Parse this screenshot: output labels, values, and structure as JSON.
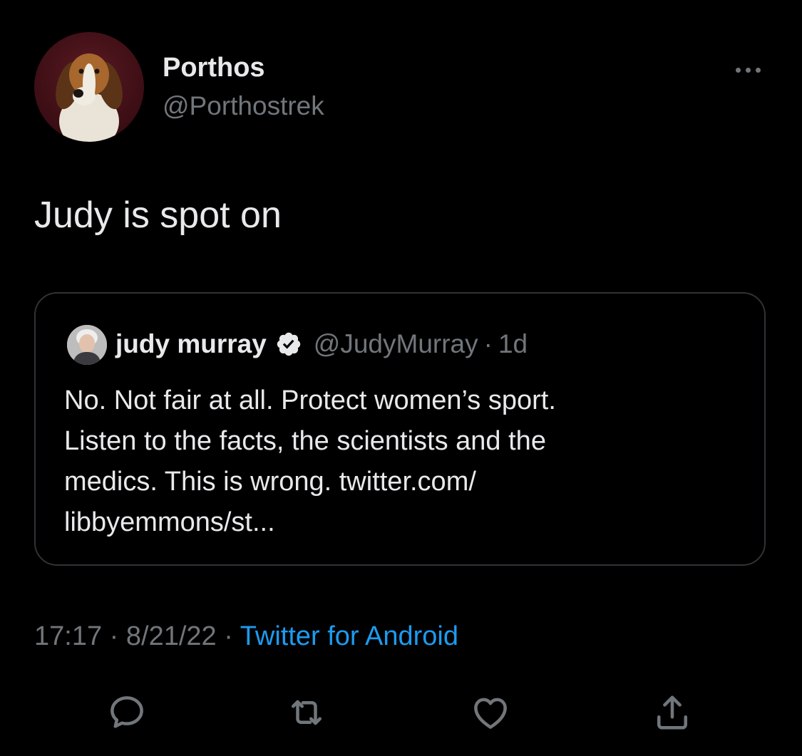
{
  "tweet": {
    "author_name": "Porthos",
    "author_handle": "@Porthostrek",
    "text": "Judy is spot on",
    "timestamp_time": "17:17",
    "separator": "·",
    "timestamp_date": "8/21/22",
    "source": "Twitter for Android"
  },
  "quote": {
    "author_name": "judy murray",
    "author_handle": "@JudyMurray",
    "separator": "·",
    "time": "1d",
    "lines": [
      "No. Not fair at all.  Protect women’s sport.",
      "Listen to the facts, the scientists and the",
      "medics. This is wrong. twitter.com/",
      "libbyemmons/st..."
    ]
  },
  "icons": {
    "more": "more-icon",
    "verified": "verified-icon",
    "reply": "reply-icon",
    "retweet": "retweet-icon",
    "like": "heart-icon",
    "share": "share-icon"
  },
  "colors": {
    "background": "#000000",
    "primary_text": "#e7e9ea",
    "secondary_text": "#71767b",
    "accent": "#1d9bf0",
    "border": "#2f3336"
  }
}
